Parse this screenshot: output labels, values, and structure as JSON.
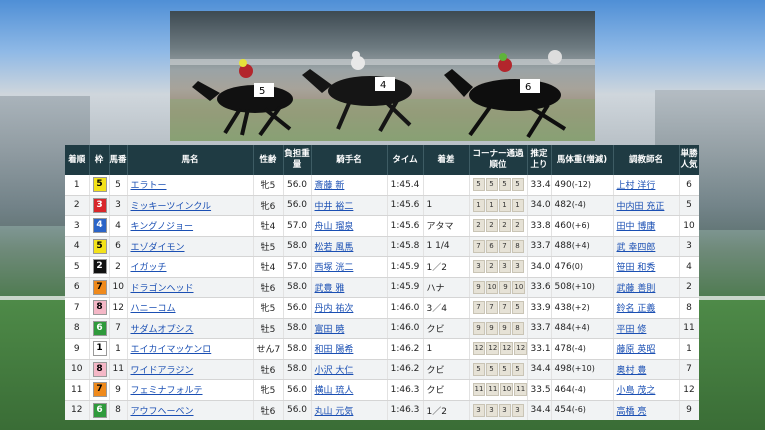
{
  "headers": [
    "着順",
    "枠",
    "馬番",
    "馬名",
    "性齢",
    "負担重量",
    "騎手名",
    "タイム",
    "着差",
    "コーナー通過順位",
    "推定上り",
    "馬体重(増減)",
    "調教師名",
    "単勝人気"
  ],
  "rows": [
    {
      "rank": "1",
      "waku": "5",
      "waku_bg": "#f3e21a",
      "waku_fg": "#000",
      "num": "5",
      "horse": "エラトー",
      "sexage": "牝5",
      "weight": "56.0",
      "jockey": "斎藤 新",
      "time": "1:45.4",
      "margin": "",
      "corners": [
        "5",
        "5",
        "5",
        "5"
      ],
      "last3f": "33.4",
      "body": "490",
      "body_diff": "(-12)",
      "trainer": "上村 洋行",
      "pop": "6"
    },
    {
      "rank": "2",
      "waku": "3",
      "waku_bg": "#d8262a",
      "waku_fg": "#fff",
      "num": "3",
      "horse": "ミッキーツインクル",
      "sexage": "牝6",
      "weight": "56.0",
      "jockey": "中井 裕二",
      "time": "1:45.6",
      "margin": "1",
      "corners": [
        "1",
        "1",
        "1",
        "1"
      ],
      "last3f": "34.0",
      "body": "482",
      "body_diff": "(-4)",
      "trainer": "中内田 充正",
      "pop": "5"
    },
    {
      "rank": "3",
      "waku": "4",
      "waku_bg": "#2a64c8",
      "waku_fg": "#fff",
      "num": "4",
      "horse": "キングノジョー",
      "sexage": "牡4",
      "weight": "57.0",
      "jockey": "舟山 瑠泉",
      "time": "1:45.6",
      "margin": "アタマ",
      "corners": [
        "2",
        "2",
        "2",
        "2"
      ],
      "last3f": "33.8",
      "body": "460",
      "body_diff": "(+6)",
      "trainer": "田中 博康",
      "pop": "10"
    },
    {
      "rank": "4",
      "waku": "5",
      "waku_bg": "#f3e21a",
      "waku_fg": "#000",
      "num": "6",
      "horse": "エゾダイモン",
      "sexage": "牡5",
      "weight": "58.0",
      "jockey": "松若 風馬",
      "time": "1:45.8",
      "margin": "1 1/4",
      "corners": [
        "7",
        "6",
        "7",
        "8"
      ],
      "last3f": "33.7",
      "body": "488",
      "body_diff": "(+4)",
      "trainer": "武 幸四郎",
      "pop": "3"
    },
    {
      "rank": "5",
      "waku": "2",
      "waku_bg": "#111111",
      "waku_fg": "#fff",
      "num": "2",
      "horse": "イガッチ",
      "sexage": "牡4",
      "weight": "57.0",
      "jockey": "西塚 洸二",
      "time": "1:45.9",
      "margin": "1／2",
      "corners": [
        "3",
        "2",
        "3",
        "3"
      ],
      "last3f": "34.0",
      "body": "476",
      "body_diff": "(0)",
      "trainer": "笹田 和秀",
      "pop": "4"
    },
    {
      "rank": "6",
      "waku": "7",
      "waku_bg": "#ef8a1c",
      "waku_fg": "#000",
      "num": "10",
      "horse": "ドラゴンヘッド",
      "sexage": "牡6",
      "weight": "58.0",
      "jockey": "武豊 雅",
      "time": "1:45.9",
      "margin": "ハナ",
      "corners": [
        "9",
        "10",
        "9",
        "10"
      ],
      "last3f": "33.6",
      "body": "508",
      "body_diff": "(+10)",
      "trainer": "武藤 善則",
      "pop": "2"
    },
    {
      "rank": "7",
      "waku": "8",
      "waku_bg": "#f4b7c6",
      "waku_fg": "#000",
      "num": "12",
      "horse": "ハニーコム",
      "sexage": "牝5",
      "weight": "56.0",
      "jockey": "丹内 祐次",
      "time": "1:46.0",
      "margin": "3／4",
      "corners": [
        "7",
        "7",
        "7",
        "5"
      ],
      "last3f": "33.9",
      "body": "438",
      "body_diff": "(+2)",
      "trainer": "鈴名 正義",
      "pop": "8"
    },
    {
      "rank": "8",
      "waku": "6",
      "waku_bg": "#2f9a3c",
      "waku_fg": "#fff",
      "num": "7",
      "horse": "サダムオプシス",
      "sexage": "牡5",
      "weight": "58.0",
      "jockey": "富田 暁",
      "time": "1:46.0",
      "margin": "クビ",
      "corners": [
        "9",
        "9",
        "9",
        "8"
      ],
      "last3f": "33.7",
      "body": "484",
      "body_diff": "(+4)",
      "trainer": "平田 修",
      "pop": "11"
    },
    {
      "rank": "9",
      "waku": "1",
      "waku_bg": "#ffffff",
      "waku_fg": "#000",
      "num": "1",
      "horse": "エイカイマッケンロ",
      "sexage": "せん7",
      "weight": "58.0",
      "jockey": "和田 陽希",
      "time": "1:46.2",
      "margin": "1",
      "corners": [
        "12",
        "12",
        "12",
        "12"
      ],
      "last3f": "33.1",
      "body": "478",
      "body_diff": "(-4)",
      "trainer": "藤原 英昭",
      "pop": "1"
    },
    {
      "rank": "10",
      "waku": "8",
      "waku_bg": "#f4b7c6",
      "waku_fg": "#000",
      "num": "11",
      "horse": "ワイドアラジン",
      "sexage": "牡6",
      "weight": "58.0",
      "jockey": "小沢 大仁",
      "time": "1:46.2",
      "margin": "クビ",
      "corners": [
        "5",
        "5",
        "5",
        "5"
      ],
      "last3f": "34.4",
      "body": "498",
      "body_diff": "(+10)",
      "trainer": "奥村 豊",
      "pop": "7"
    },
    {
      "rank": "11",
      "waku": "7",
      "waku_bg": "#ef8a1c",
      "waku_fg": "#000",
      "num": "9",
      "horse": "フェミナフォルテ",
      "sexage": "牝5",
      "weight": "56.0",
      "jockey": "横山 琉人",
      "time": "1:46.3",
      "margin": "クビ",
      "corners": [
        "11",
        "11",
        "10",
        "11"
      ],
      "last3f": "33.5",
      "body": "464",
      "body_diff": "(-4)",
      "trainer": "小島 茂之",
      "pop": "12"
    },
    {
      "rank": "12",
      "waku": "6",
      "waku_bg": "#2f9a3c",
      "waku_fg": "#fff",
      "num": "8",
      "horse": "アウフヘーベン",
      "sexage": "牡6",
      "weight": "56.0",
      "jockey": "丸山 元気",
      "time": "1:46.3",
      "margin": "1／2",
      "corners": [
        "3",
        "3",
        "3",
        "3"
      ],
      "last3f": "34.4",
      "body": "454",
      "body_diff": "(-6)",
      "trainer": "高橋 亮",
      "pop": "9"
    }
  ],
  "video": {
    "saddle_numbers": [
      "5",
      "4",
      "6"
    ]
  }
}
